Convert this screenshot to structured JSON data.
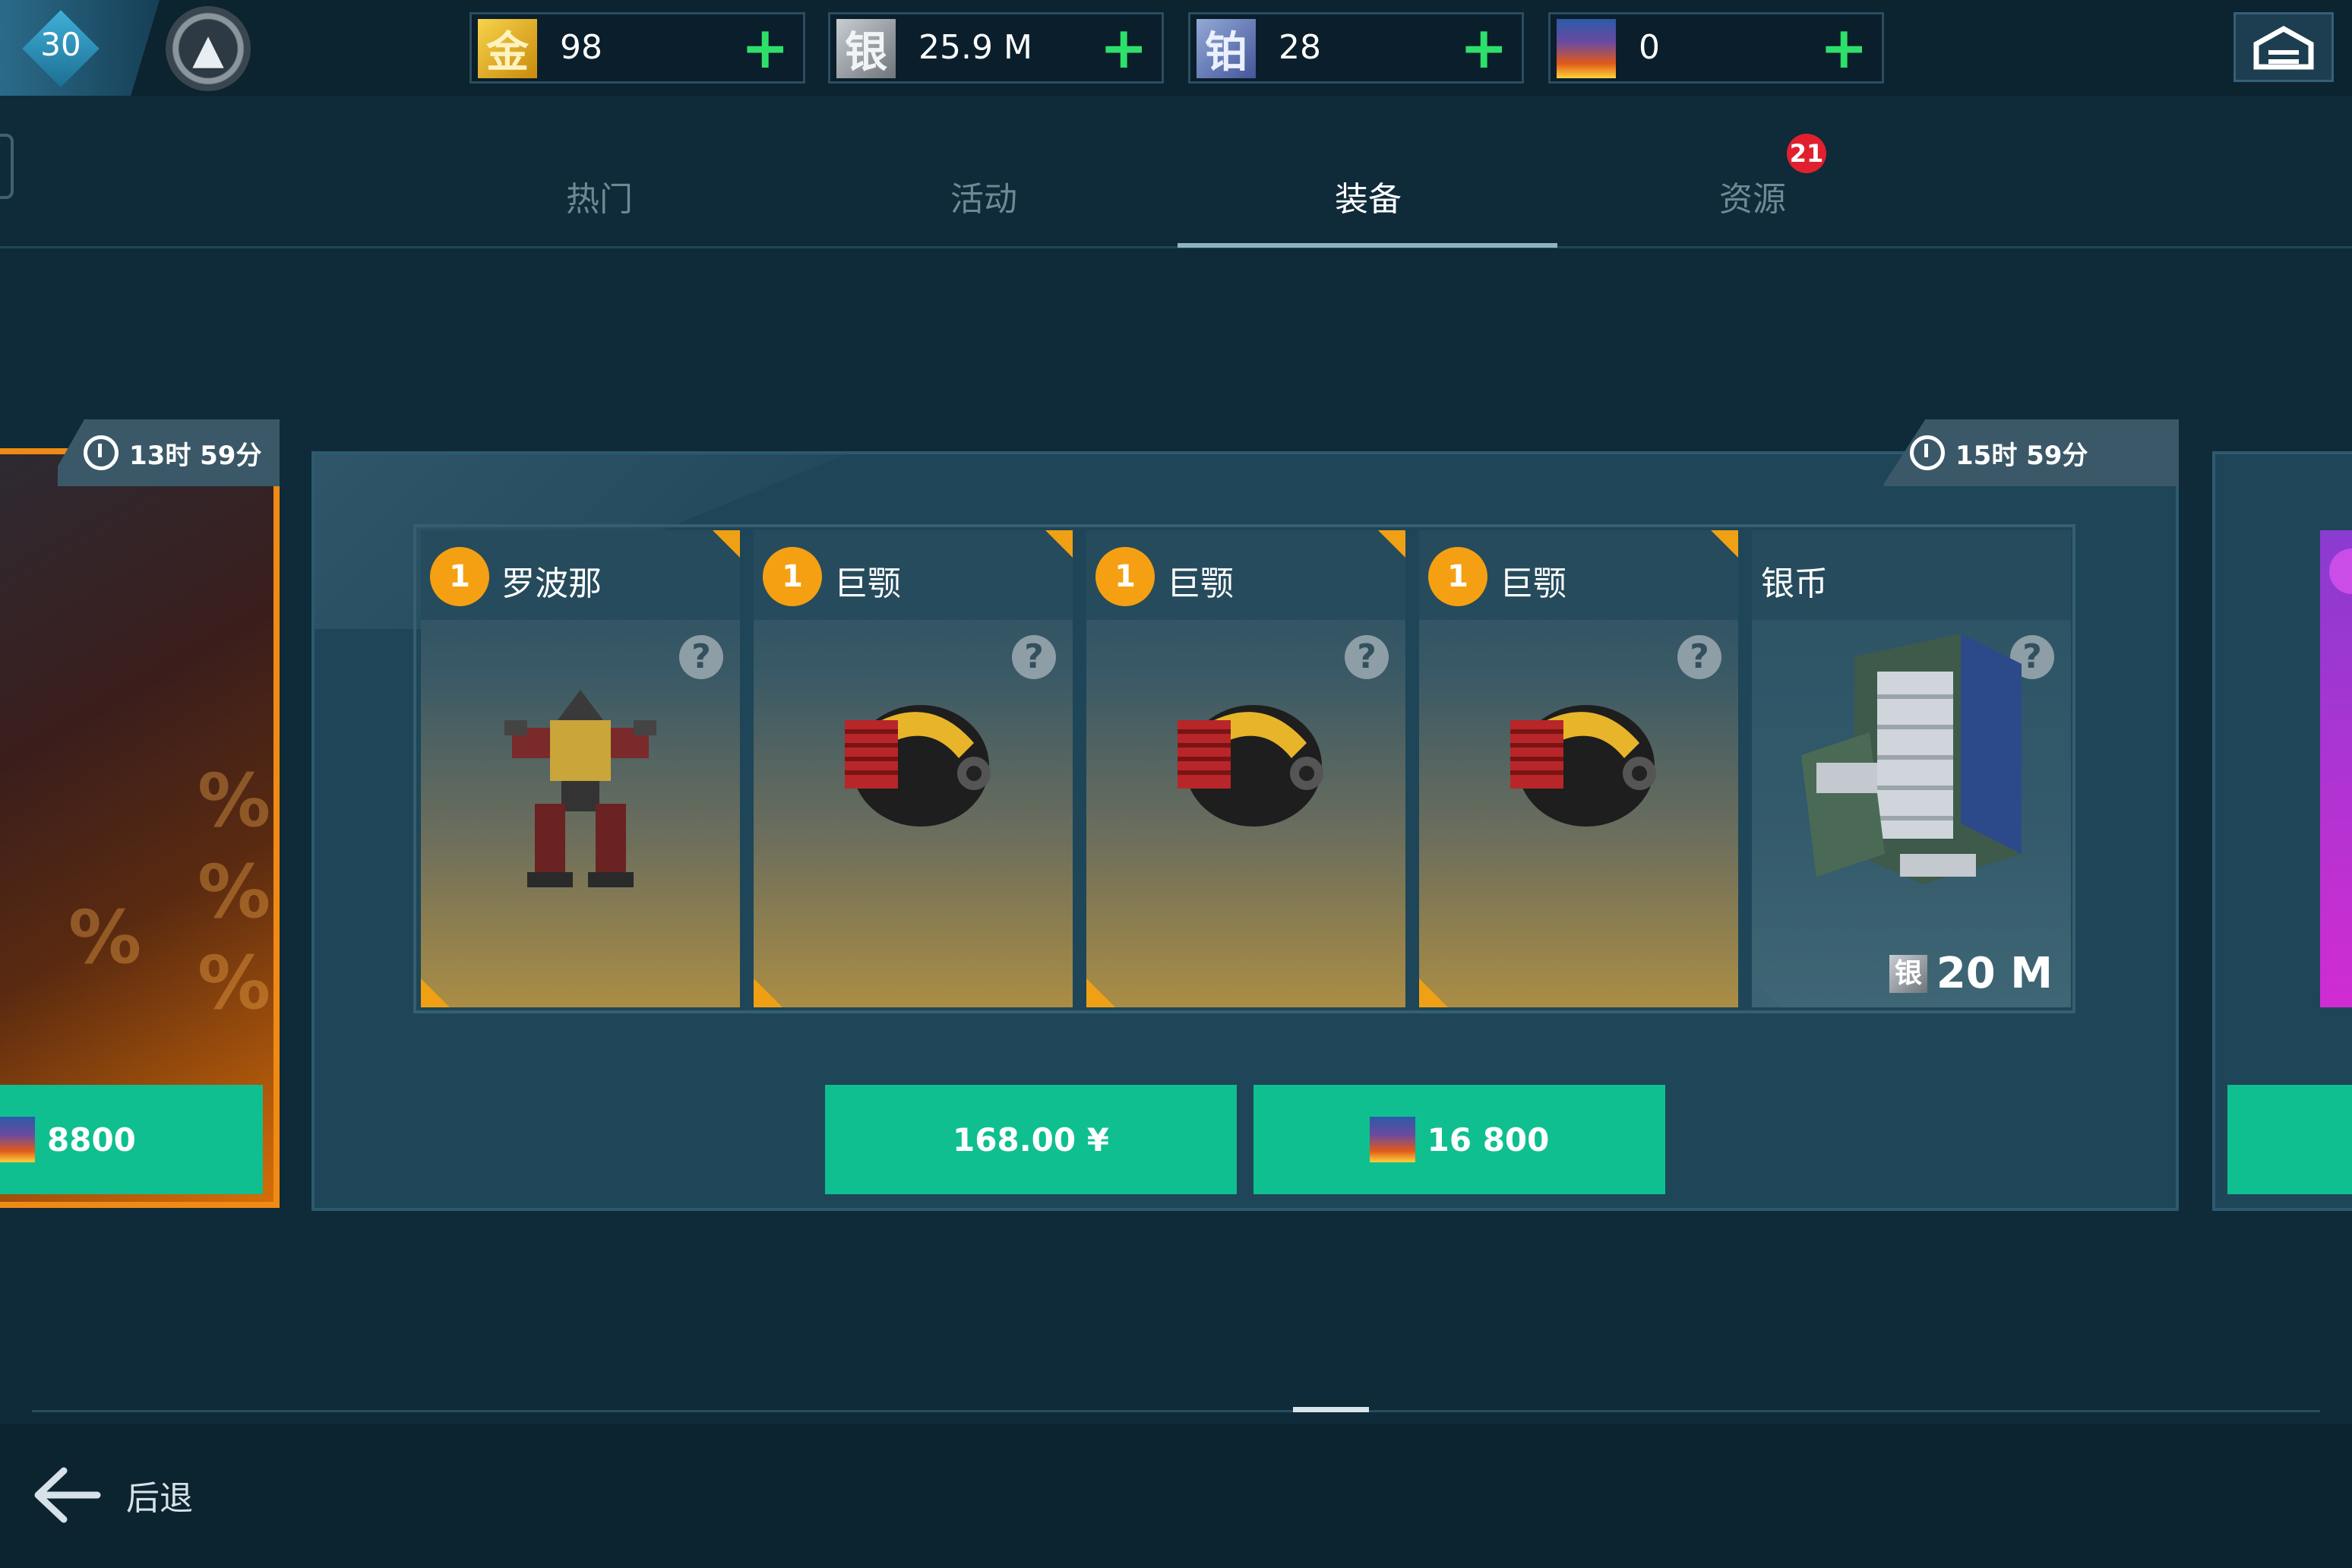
{
  "player": {
    "level": "30",
    "rank_icon": "rank-emblem-icon"
  },
  "currencies": [
    {
      "name": "gold",
      "icon_glyph": "金",
      "value": "98",
      "plus": "+"
    },
    {
      "name": "silver",
      "icon_glyph": "银",
      "value": "25.9 M",
      "plus": "+"
    },
    {
      "name": "platinum",
      "icon_glyph": "铂",
      "value": "28",
      "plus": "+"
    },
    {
      "name": "energy",
      "icon_glyph": "",
      "value": "0",
      "plus": "+"
    }
  ],
  "tabs": [
    {
      "label": "热门",
      "active": false
    },
    {
      "label": "活动",
      "active": false
    },
    {
      "label": "装备",
      "active": true
    },
    {
      "label": "资源",
      "active": false
    }
  ],
  "tab_badge": "21",
  "left_offer": {
    "timer": "13时 59分",
    "price": "8800",
    "price_icon": "flame-currency-icon"
  },
  "main_offer": {
    "timer": "15时 59分",
    "items": [
      {
        "qty": "1",
        "name": "罗波那",
        "icon": "robot-mech-icon",
        "help": "?"
      },
      {
        "qty": "1",
        "name": "巨颚",
        "icon": "weapon-module-icon",
        "help": "?"
      },
      {
        "qty": "1",
        "name": "巨颚",
        "icon": "weapon-module-icon",
        "help": "?"
      },
      {
        "qty": "1",
        "name": "巨颚",
        "icon": "weapon-module-icon",
        "help": "?"
      },
      {
        "qty": "",
        "name": "银币",
        "icon": "silver-crate-icon",
        "help": "?",
        "amount_tag": "银",
        "amount": "20 M"
      }
    ],
    "buy_cash": "168.00 ¥",
    "buy_flame": "16 800"
  },
  "bottom": {
    "back_label": "后退"
  },
  "colors": {
    "accent_green": "#0fbf90",
    "orange": "#f08a14",
    "badge_red": "#e0202e"
  }
}
